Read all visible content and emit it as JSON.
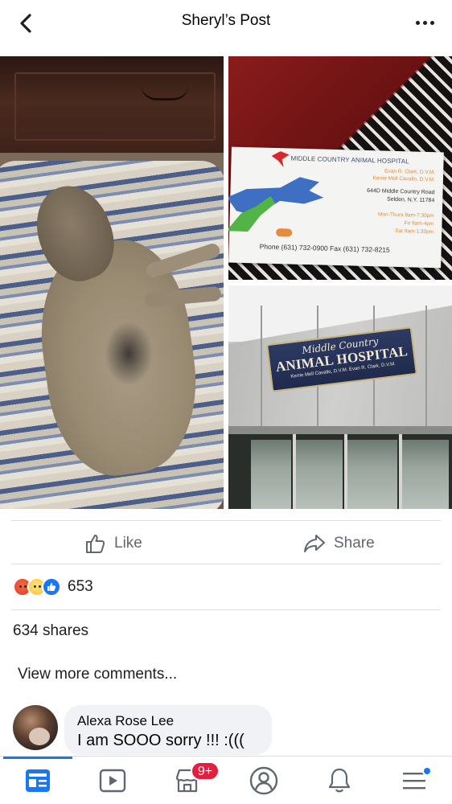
{
  "header": {
    "title": "Sheryl’s Post",
    "back_icon": "chevron-left-icon",
    "more_icon": "more-dots-icon"
  },
  "photos": {
    "card": {
      "clinic_name": "MIDDLE COUNTRY ANIMAL HOSPITAL",
      "doctor1": "Evan R. Clark, D.V.M.",
      "doctor2": "Kerrie Moll Cavallo, D.V.M.",
      "address1": "644D Middle Country Road",
      "address2": "Selden, N.Y. 11784",
      "hours1": "Mon-Thurs 9am-7:30pm",
      "hours2": "Fri 9am-4pm",
      "hours3": "Sat 9am-1:30pm",
      "phone": "Phone (631) 732-0900 Fax (631) 732-8215"
    },
    "sign": {
      "script": "Middle Country",
      "main": "ANIMAL HOSPITAL",
      "sub": "Kerrie Moll Cavallo, D.V.M.      Evan R. Clark, D.V.M."
    }
  },
  "actions": {
    "like_label": "Like",
    "share_label": "Share"
  },
  "reactions": {
    "types": [
      "angry",
      "sad",
      "like"
    ],
    "count": "653"
  },
  "shares_text": "634 shares",
  "view_more_comments": "View more comments...",
  "comment": {
    "author": "Alexa Rose Lee",
    "text": "I am SOOO sorry !!! :((("
  },
  "tabbar": {
    "tabs": [
      "news-feed-icon",
      "watch-icon",
      "marketplace-icon",
      "profile-icon",
      "notifications-icon",
      "menu-icon"
    ],
    "marketplace_badge": "9+",
    "accent": "#1877f2",
    "badge_color": "#e41e3f"
  }
}
